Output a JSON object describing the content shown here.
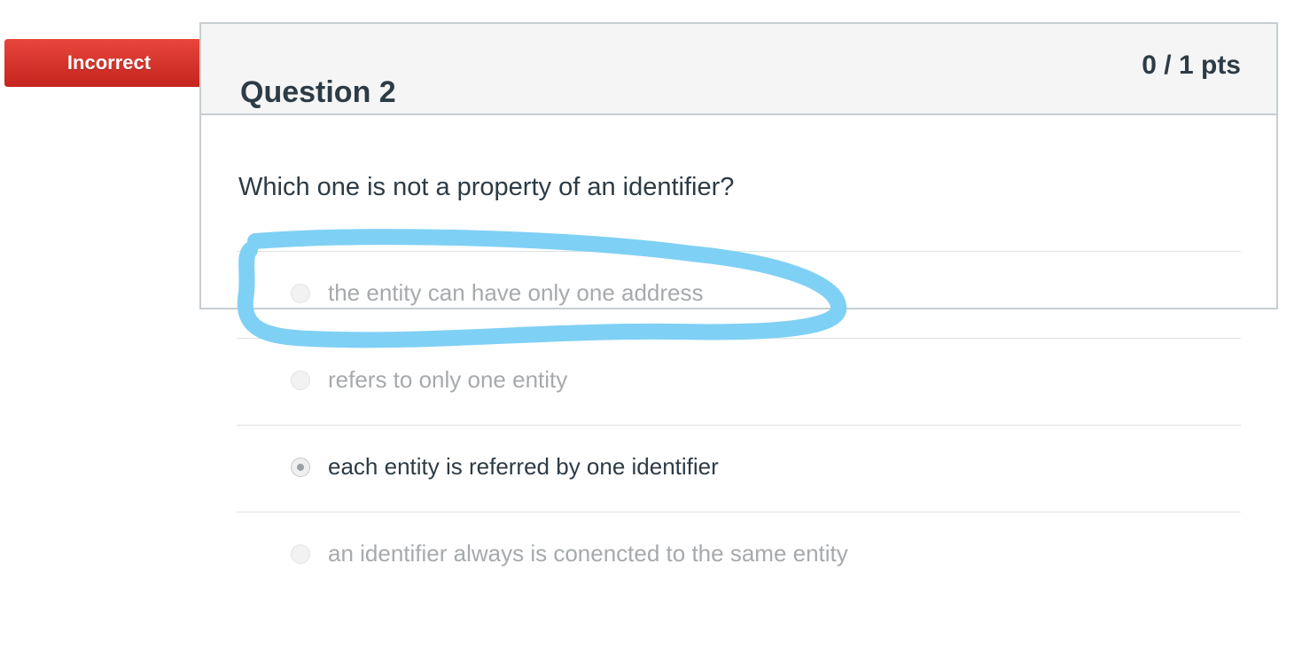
{
  "result": {
    "label": "Incorrect",
    "color": "#d9322b"
  },
  "question": {
    "title": "Question 2",
    "points": "0 / 1 pts",
    "text": "Which one is not a property of an identifier?",
    "answers": [
      {
        "label": "the entity can have only one address",
        "selected": false
      },
      {
        "label": "refers to only one entity",
        "selected": false
      },
      {
        "label": "each entity is referred by one identifier",
        "selected": true
      },
      {
        "label": "an identifier always is conencted to the same entity",
        "selected": false
      }
    ]
  },
  "annotation": {
    "color": "#7fd0f5"
  }
}
